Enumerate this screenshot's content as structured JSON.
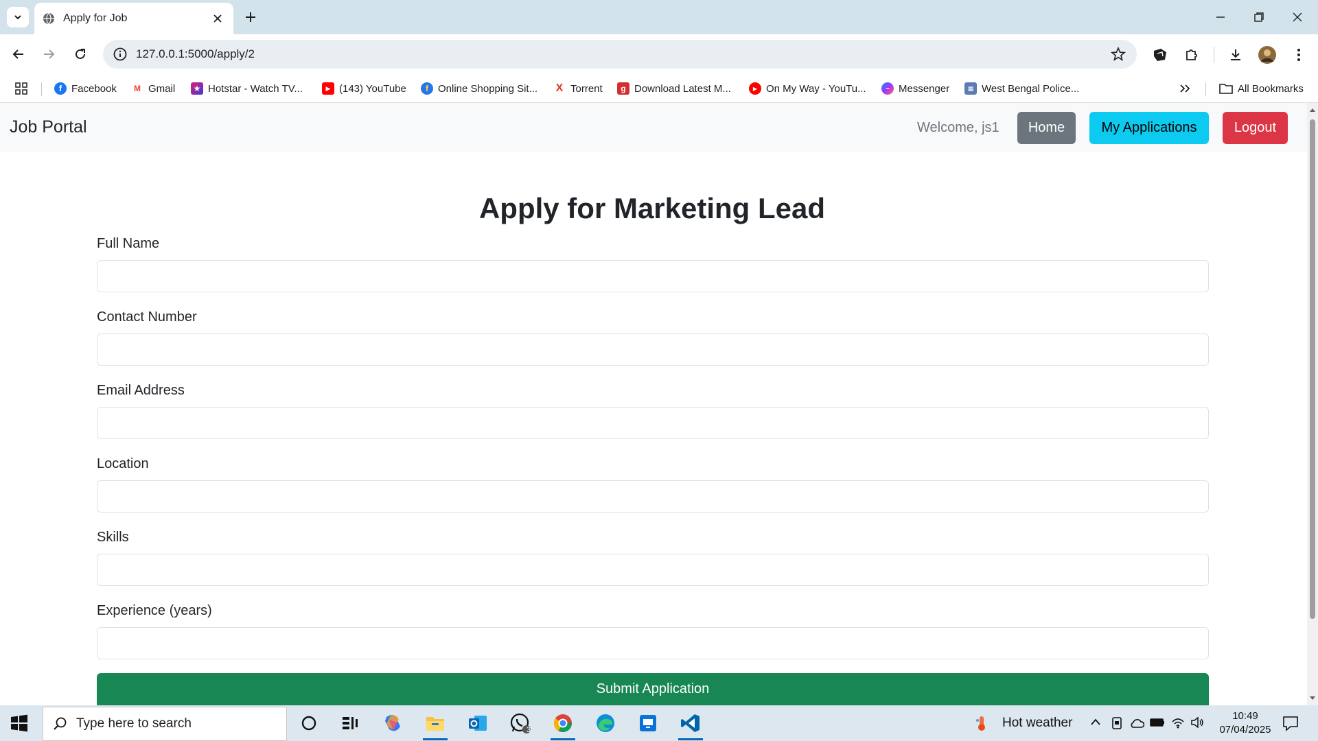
{
  "browser": {
    "tab_title": "Apply for Job",
    "url": "127.0.0.1:5000/apply/2",
    "bookmarks": [
      {
        "label": "Facebook",
        "icon": "facebook-icon",
        "color": "#1877f2"
      },
      {
        "label": "Gmail",
        "icon": "gmail-icon",
        "color": "#ea4335"
      },
      {
        "label": "Hotstar - Watch TV...",
        "icon": "hotstar-icon",
        "color": "#6d28d9"
      },
      {
        "label": "(143) YouTube",
        "icon": "youtube-icon",
        "color": "#ff0000"
      },
      {
        "label": "Online Shopping Sit...",
        "icon": "flipkart-icon",
        "color": "#2874f0"
      },
      {
        "label": "Torrent",
        "icon": "torrent-icon",
        "color": "#e03a1e"
      },
      {
        "label": "Download Latest M...",
        "icon": "download-site-icon",
        "color": "#d32f2f"
      },
      {
        "label": "On My Way - YouTu...",
        "icon": "youtube-music-icon",
        "color": "#ff0000"
      },
      {
        "label": "Messenger",
        "icon": "messenger-icon",
        "color": "#a334fa"
      },
      {
        "label": "West Bengal Police...",
        "icon": "police-icon",
        "color": "#5b7bb5"
      }
    ],
    "all_bookmarks": "All Bookmarks"
  },
  "navbar": {
    "brand": "Job Portal",
    "welcome": "Welcome, js1",
    "home_label": "Home",
    "applications_label": "My Applications",
    "logout_label": "Logout"
  },
  "form": {
    "heading": "Apply for Marketing Lead",
    "fields": [
      {
        "label": "Full Name",
        "value": ""
      },
      {
        "label": "Contact Number",
        "value": ""
      },
      {
        "label": "Email Address",
        "value": ""
      },
      {
        "label": "Location",
        "value": ""
      },
      {
        "label": "Skills",
        "value": ""
      },
      {
        "label": "Experience (years)",
        "value": ""
      }
    ],
    "submit_label": "Submit Application"
  },
  "taskbar": {
    "search_placeholder": "Type here to search",
    "weather": "Hot weather",
    "time": "10:49",
    "date": "07/04/2025",
    "whatsapp_badge": "3"
  },
  "colors": {
    "home_button": "#6c757d",
    "applications_button": "#0dcaf0",
    "logout_button": "#dc3545",
    "submit_button": "#198754"
  }
}
